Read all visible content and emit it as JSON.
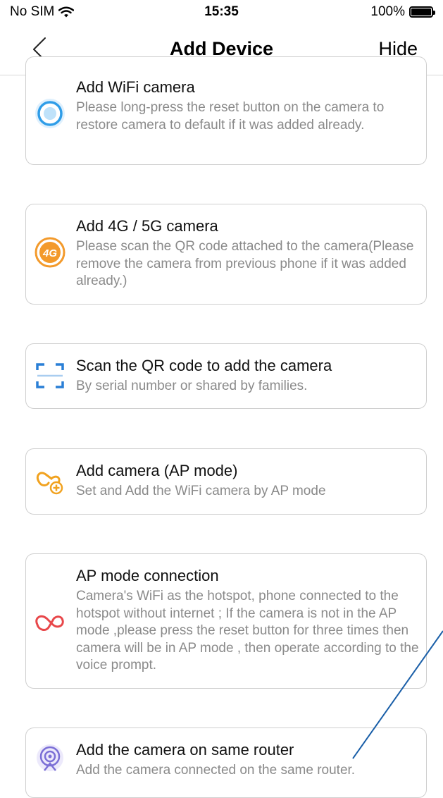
{
  "status_bar": {
    "carrier": "No SIM",
    "time": "15:35",
    "battery": "100%"
  },
  "nav": {
    "title": "Add Device",
    "hide_label": "Hide"
  },
  "options": [
    {
      "title": "Add WiFi camera",
      "desc": "Please long-press the reset button on the camera to restore camera to default if it was added already.",
      "icon": "wifi-camera-icon",
      "color": "#2f9de8"
    },
    {
      "title": "Add 4G / 5G camera",
      "desc": "Please scan the QR code attached to the camera(Please remove the camera from previous phone if it was added already.)",
      "icon": "4g-camera-icon",
      "icon_text": "4G",
      "color": "#f39a2b"
    },
    {
      "title": "Scan the QR code to add the camera",
      "desc": "By serial number or shared by families.",
      "icon": "qr-scan-icon",
      "color": "#2a7fd6"
    },
    {
      "title": "Add camera (AP mode)",
      "desc": "Set and Add the WiFi camera by AP mode",
      "icon": "ap-add-icon",
      "color": "#f1a21f"
    },
    {
      "title": "AP mode connection",
      "desc": "Camera's WiFi as the hotspot, phone connected to the hotspot without internet ; If the camera is not in the AP mode ,please press the reset button for three times then camera will be in AP mode , then operate according to the voice prompt.",
      "icon": "ap-connection-icon",
      "color": "#e8474a"
    },
    {
      "title": "Add the camera on same router",
      "desc": "Add the camera connected on the same router.",
      "icon": "router-icon",
      "color": "#7b6fd6"
    }
  ],
  "annotation": {
    "color": "#1a5fa8"
  }
}
